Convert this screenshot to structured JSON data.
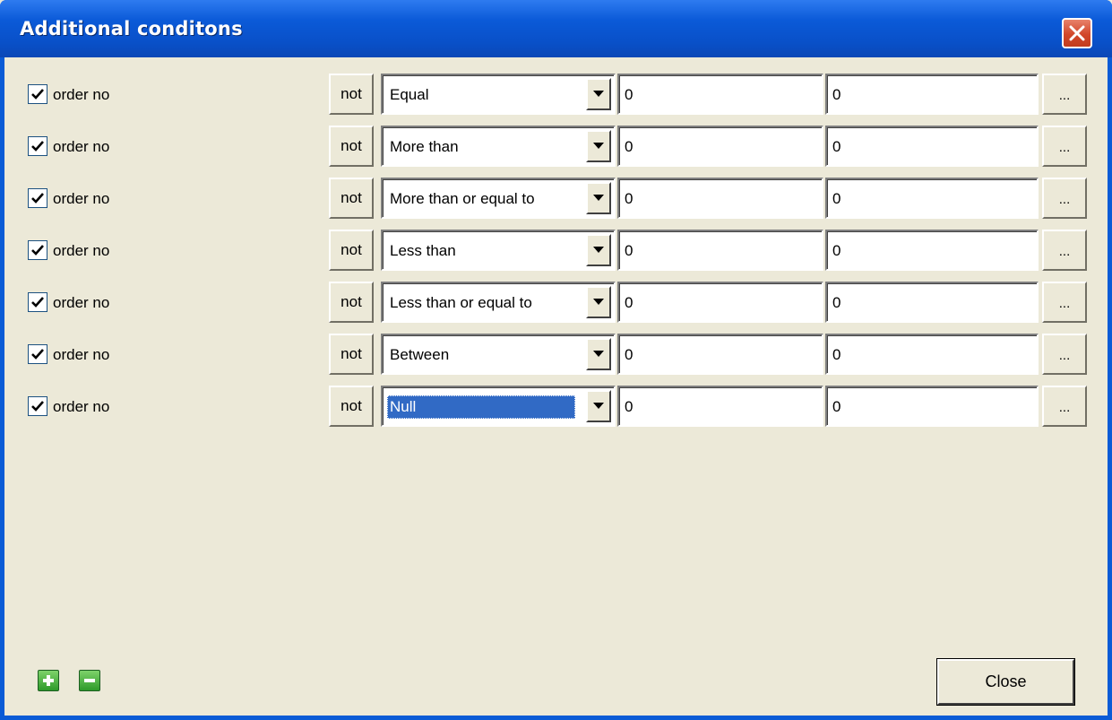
{
  "window": {
    "title": "Additional conditons"
  },
  "rows": [
    {
      "checked": true,
      "label": "order no",
      "not_label": "not",
      "operator": "Equal",
      "value1": "0",
      "value2": "0",
      "browse_label": "...",
      "selected": false
    },
    {
      "checked": true,
      "label": "order no",
      "not_label": "not",
      "operator": "More than",
      "value1": "0",
      "value2": "0",
      "browse_label": "...",
      "selected": false
    },
    {
      "checked": true,
      "label": "order no",
      "not_label": "not",
      "operator": "More than or equal to",
      "value1": "0",
      "value2": "0",
      "browse_label": "...",
      "selected": false
    },
    {
      "checked": true,
      "label": "order no",
      "not_label": "not",
      "operator": "Less than",
      "value1": "0",
      "value2": "0",
      "browse_label": "...",
      "selected": false
    },
    {
      "checked": true,
      "label": "order no",
      "not_label": "not",
      "operator": "Less than or equal to",
      "value1": "0",
      "value2": "0",
      "browse_label": "...",
      "selected": false
    },
    {
      "checked": true,
      "label": "order no",
      "not_label": "not",
      "operator": "Between",
      "value1": "0",
      "value2": "0",
      "browse_label": "...",
      "selected": false
    },
    {
      "checked": true,
      "label": "order no",
      "not_label": "not",
      "operator": "Null",
      "value1": "0",
      "value2": "0",
      "browse_label": "...",
      "selected": true
    }
  ],
  "footer": {
    "add_icon": "plus-icon",
    "remove_icon": "minus-icon",
    "close_label": "Close"
  },
  "colors": {
    "titlebar": "#0A5BD6",
    "client_bg": "#ECE9D8",
    "selection": "#316AC5",
    "close_button": "#D2472A"
  }
}
